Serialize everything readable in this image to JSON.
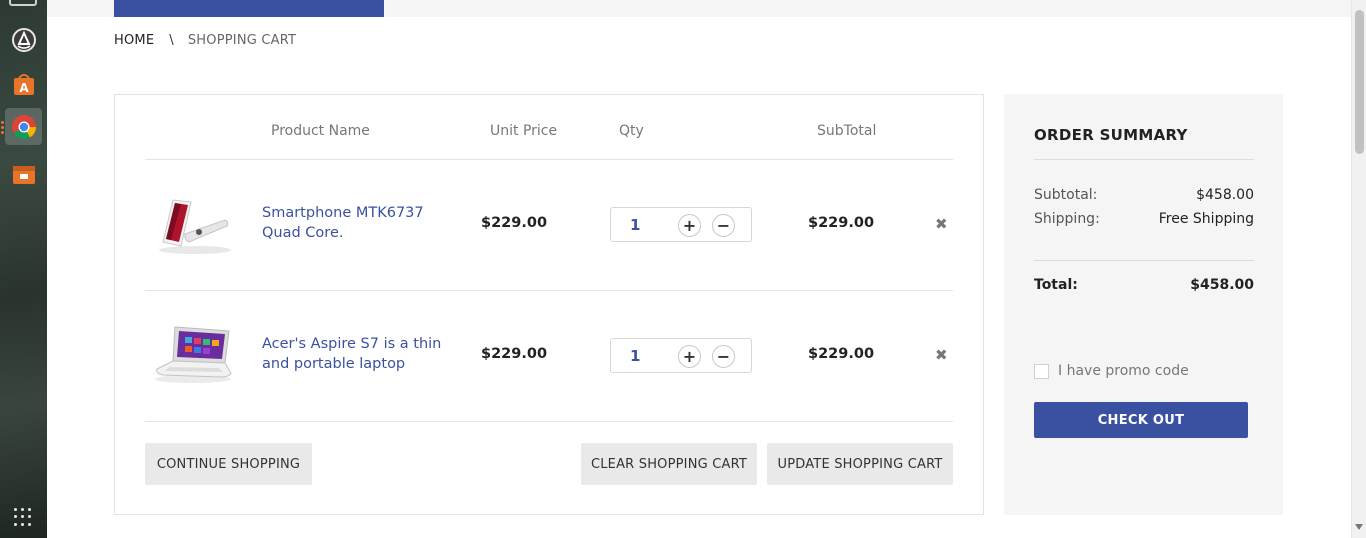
{
  "breadcrumb": {
    "home": "HOME",
    "separator": "\\",
    "current": "SHOPPING CART"
  },
  "cart": {
    "headers": {
      "product": "Product Name",
      "unit_price": "Unit Price",
      "qty": "Qty",
      "subtotal": "SubTotal"
    },
    "items": [
      {
        "name": "Smartphone MTK6737 Quad Core.",
        "unit_price": "$229.00",
        "qty": "1",
        "subtotal": "$229.00",
        "image_icon": "smartphone-image"
      },
      {
        "name": "Acer's Aspire S7 is a thin and portable laptop",
        "unit_price": "$229.00",
        "qty": "1",
        "subtotal": "$229.00",
        "image_icon": "laptop-image"
      }
    ],
    "qty_plus": "+",
    "qty_minus": "−",
    "remove": "✖",
    "buttons": {
      "continue": "CONTINUE SHOPPING",
      "clear": "CLEAR SHOPPING CART",
      "update": "UPDATE SHOPPING CART"
    }
  },
  "summary": {
    "title": "ORDER SUMMARY",
    "subtotal_label": "Subtotal:",
    "subtotal_value": "$458.00",
    "shipping_label": "Shipping:",
    "shipping_value": "Free Shipping",
    "total_label": "Total:",
    "total_value": "$458.00",
    "promo_label": "I have promo code",
    "checkout": "CHECK OUT"
  },
  "colors": {
    "accent": "#3a51a1",
    "button_grey": "#e9e9e9",
    "summary_bg": "#f5f5f5"
  },
  "dock": {
    "icons": [
      "window-icon",
      "software-updater-icon",
      "software-center-icon",
      "chrome-icon",
      "files-icon",
      "apps-grid-icon"
    ]
  }
}
